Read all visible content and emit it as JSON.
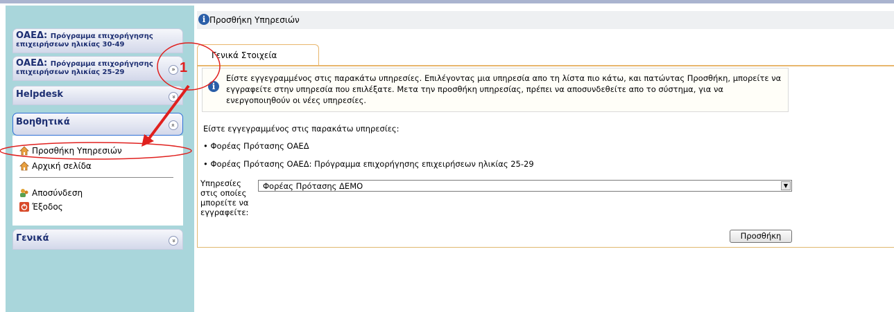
{
  "sidebar": {
    "panels": [
      {
        "title_main": "ΟΑΕΔ:",
        "title_rest": "Πρόγραμμα επιχορήγησης",
        "title_line2": "επιχειρήσεων ηλικίας 30-49"
      },
      {
        "title_main": "ΟΑΕΔ:",
        "title_rest": "Πρόγραμμα επιχορήγησης",
        "title_line2": "επιχειρήσεων ηλικίας 25-29"
      },
      {
        "title_main": "Helpdesk"
      },
      {
        "title_main": "Βοηθητικά"
      },
      {
        "title_main": "Γενικά"
      }
    ],
    "links": [
      {
        "label": "Προσθήκη Υπηρεσιών",
        "icon": "home-icon"
      },
      {
        "label": "Αρχική σελίδα",
        "icon": "home-icon"
      },
      {
        "label": "Αποσύνδεση",
        "icon": "users-icon"
      },
      {
        "label": "Έξοδος",
        "icon": "power-icon"
      }
    ]
  },
  "header": {
    "title": "Προσθήκη Υπηρεσιών"
  },
  "tab": {
    "label": "Γενικά Στοιχεία"
  },
  "info": {
    "text": "Είστε εγγεγραμμένος στις παρακάτω υπηρεσίες. Επιλέγοντας μια υπηρεσία απο τη λίστα πιο κάτω, και πατώντας Προσθήκη, μπορείτε να εγγραφείτε στην υπηρεσία που επιλέξατε. Μετα την προσθήκη υπηρεσίας, πρέπει να αποσυνδεθείτε απο το σύστημα, για να ενεργοποιηθούν οι νέες υπηρεσίες."
  },
  "registered": {
    "intro": "Είστε εγγεγραμμένος στις παρακάτω υπηρεσίες:",
    "items": [
      "Φορέας Πρότασης ΟΑΕΔ",
      "Φορέας Πρότασης ΟΑΕΔ: Πρόγραμμα επιχορήγησης επιχειρήσεων ηλικίας 25-29"
    ]
  },
  "form": {
    "label": "Υπηρεσίες στις οποίες μπορείτε να εγγραφείτε:",
    "selected": "Φορέας Πρότασης ΔΕΜΟ",
    "button": "Προσθήκη"
  },
  "annotation": {
    "number": "1"
  },
  "colors": {
    "sidebar": "#a9d6db",
    "tab_border": "#e8b66c",
    "annotation": "#e0201e",
    "title": "#1d2f72"
  }
}
